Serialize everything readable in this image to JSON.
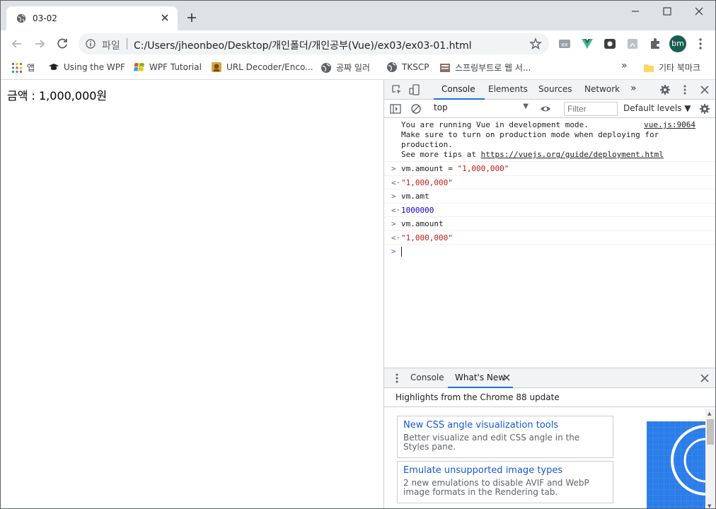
{
  "browser": {
    "tab_title": "03-02",
    "omnibox": {
      "scheme_label": "파일",
      "url": "C:/Users/jheonbeo/Desktop/개인폴더/개인공부(Vue)/ex03/ex03-01.html"
    },
    "profile_initials": "bm",
    "bookmarks": [
      {
        "label": "앱",
        "icon": "apps-grid-icon"
      },
      {
        "label": "Using the WPF",
        "icon": "graduation-cap-icon"
      },
      {
        "label": "WPF Tutorial",
        "icon": "windows-logo-icon"
      },
      {
        "label": "URL Decoder/Enco...",
        "icon": "site-favicon"
      },
      {
        "label": "공짜 일러",
        "icon": "globe-icon"
      },
      {
        "label": "TKSCP",
        "icon": "globe-icon"
      },
      {
        "label": "스프링부트로 웹 서...",
        "icon": "book-icon"
      }
    ],
    "other_bookmarks": "기타 북마크",
    "overflow_chevron": "»"
  },
  "page": {
    "amount_text": "금액 : 1,000,000원"
  },
  "devtools": {
    "tabs": [
      "Console",
      "Elements",
      "Sources",
      "Network"
    ],
    "more_tabs": "»",
    "context": "top",
    "filter_placeholder": "Filter",
    "levels": "Default levels ▼",
    "messages": {
      "vue_line1": "You are running Vue in development mode.",
      "vue_line2": "Make sure to turn on production mode when deploying for",
      "vue_line3": "production.",
      "vue_line4_prefix": "See more tips at ",
      "vue_link": "https://vuejs.org/guide/deployment.html",
      "vue_source": "vue.js:9064",
      "cmd1": "vm.amount = ",
      "cmd1_str": "\"1,000,000\"",
      "res1": "\"1,000,000\"",
      "cmd2": "vm.amt",
      "res2": "1000000",
      "cmd3": "vm.amount",
      "res3": "\"1,000,000\""
    },
    "drawer": {
      "tabs": [
        "Console",
        "What's New"
      ],
      "highlights": "Highlights from the Chrome 88 update",
      "cards": [
        {
          "title": "New CSS angle visualization tools",
          "desc": "Better visualize and edit CSS angle in the Styles pane."
        },
        {
          "title": "Emulate unsupported image types",
          "desc": "2 new emulations to disable AVIF and WebP image formats in the Rendering tab."
        }
      ]
    }
  },
  "colors": {
    "accent": "#1a73e8",
    "string": "#c41a16",
    "number": "#1c00cf",
    "link": "#1558d6",
    "avatar": "#185f50"
  }
}
